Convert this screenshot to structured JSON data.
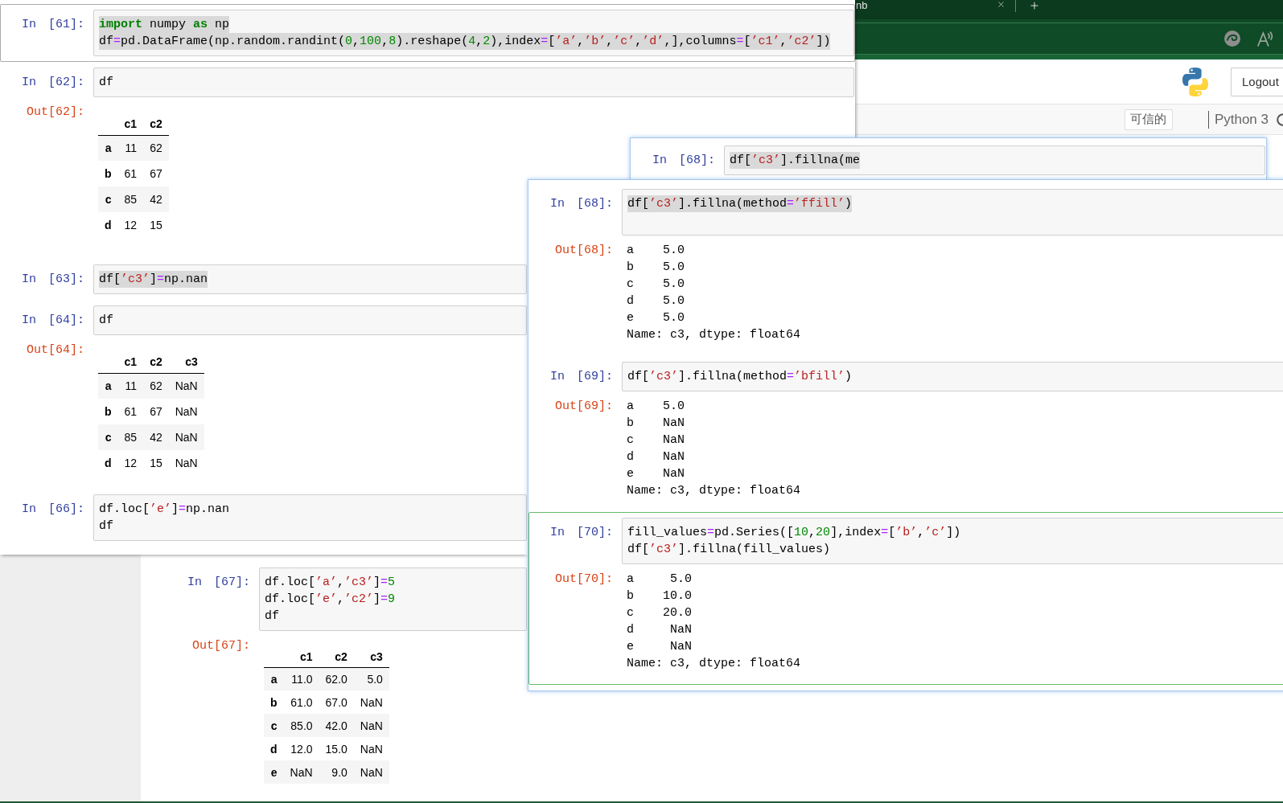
{
  "browser": {
    "tab_title": "nb"
  },
  "notebook_header": {
    "logout_label": "Logout"
  },
  "notebook_toolbar": {
    "trusted_label": "可信的",
    "kernel_name": "Python 3"
  },
  "background_notebook": {
    "cells": [
      {
        "prompt": "In [67]:",
        "selected": false,
        "editing": false,
        "code": [
          {
            "highlighted": false,
            "tokens": [
              {
                "kind": "plain",
                "text": "df.loc["
              },
              {
                "kind": "string",
                "text": "’a’"
              },
              {
                "kind": "plain",
                "text": ","
              },
              {
                "kind": "string",
                "text": "’c3’"
              },
              {
                "kind": "plain",
                "text": "]"
              },
              {
                "kind": "operator",
                "text": "="
              },
              {
                "kind": "number",
                "text": "5"
              }
            ]
          },
          {
            "highlighted": false,
            "tokens": [
              {
                "kind": "plain",
                "text": "df.loc["
              },
              {
                "kind": "string",
                "text": "’e’"
              },
              {
                "kind": "plain",
                "text": ","
              },
              {
                "kind": "string",
                "text": "’c2’"
              },
              {
                "kind": "plain",
                "text": "]"
              },
              {
                "kind": "operator",
                "text": "="
              },
              {
                "kind": "number",
                "text": "9"
              }
            ]
          },
          {
            "highlighted": false,
            "tokens": [
              {
                "kind": "plain",
                "text": "df"
              }
            ]
          }
        ],
        "output": {
          "prompt": "Out[67]:",
          "kind": "dataframe",
          "columns": [
            "c1",
            "c2",
            "c3"
          ],
          "rows": [
            {
              "index": "a",
              "values": [
                "11.0",
                "62.0",
                "5.0"
              ]
            },
            {
              "index": "b",
              "values": [
                "61.0",
                "67.0",
                "NaN"
              ]
            },
            {
              "index": "c",
              "values": [
                "85.0",
                "42.0",
                "NaN"
              ]
            },
            {
              "index": "d",
              "values": [
                "12.0",
                "15.0",
                "NaN"
              ]
            },
            {
              "index": "e",
              "values": [
                "NaN",
                "9.0",
                "NaN"
              ]
            }
          ]
        }
      }
    ]
  },
  "snippets": [
    {
      "cells": [
        {
          "prompt": "In [61]:",
          "selected": true,
          "editing": false,
          "code": [
            {
              "highlighted": true,
              "tokens": [
                {
                  "kind": "keyword",
                  "text": "import"
                },
                {
                  "kind": "plain",
                  "text": " numpy "
                },
                {
                  "kind": "keyword",
                  "text": "as"
                },
                {
                  "kind": "plain",
                  "text": " np"
                }
              ]
            },
            {
              "highlighted": true,
              "tokens": [
                {
                  "kind": "plain",
                  "text": "df"
                },
                {
                  "kind": "operator",
                  "text": "="
                },
                {
                  "kind": "plain",
                  "text": "pd.DataFrame(np.random.randint("
                },
                {
                  "kind": "number",
                  "text": "0"
                },
                {
                  "kind": "plain",
                  "text": ","
                },
                {
                  "kind": "number",
                  "text": "100"
                },
                {
                  "kind": "plain",
                  "text": ","
                },
                {
                  "kind": "number",
                  "text": "8"
                },
                {
                  "kind": "plain",
                  "text": ").reshape("
                },
                {
                  "kind": "number",
                  "text": "4"
                },
                {
                  "kind": "plain",
                  "text": ","
                },
                {
                  "kind": "number",
                  "text": "2"
                },
                {
                  "kind": "plain",
                  "text": "),index"
                },
                {
                  "kind": "operator",
                  "text": "="
                },
                {
                  "kind": "plain",
                  "text": "["
                },
                {
                  "kind": "string",
                  "text": "’a’"
                },
                {
                  "kind": "plain",
                  "text": ","
                },
                {
                  "kind": "string",
                  "text": "’b’"
                },
                {
                  "kind": "plain",
                  "text": ","
                },
                {
                  "kind": "string",
                  "text": "’c’"
                },
                {
                  "kind": "plain",
                  "text": ","
                },
                {
                  "kind": "string",
                  "text": "’d’"
                },
                {
                  "kind": "plain",
                  "text": ",],columns"
                },
                {
                  "kind": "operator",
                  "text": "="
                },
                {
                  "kind": "plain",
                  "text": "["
                },
                {
                  "kind": "string",
                  "text": "’c1’"
                },
                {
                  "kind": "plain",
                  "text": ","
                },
                {
                  "kind": "string",
                  "text": "’c2’"
                },
                {
                  "kind": "plain",
                  "text": "])"
                }
              ]
            }
          ]
        },
        {
          "prompt": "In [62]:",
          "selected": false,
          "editing": false,
          "code": [
            {
              "highlighted": false,
              "tokens": [
                {
                  "kind": "plain",
                  "text": "df"
                }
              ]
            }
          ],
          "output": {
            "prompt": "Out[62]:",
            "kind": "dataframe",
            "columns": [
              "c1",
              "c2"
            ],
            "rows": [
              {
                "index": "a",
                "values": [
                  "11",
                  "62"
                ]
              },
              {
                "index": "b",
                "values": [
                  "61",
                  "67"
                ]
              },
              {
                "index": "c",
                "values": [
                  "85",
                  "42"
                ]
              },
              {
                "index": "d",
                "values": [
                  "12",
                  "15"
                ]
              }
            ]
          }
        }
      ]
    },
    {
      "cells": [
        {
          "prompt": "In [63]:",
          "selected": false,
          "editing": false,
          "code": [
            {
              "highlighted": true,
              "tokens": [
                {
                  "kind": "plain",
                  "text": "df["
                },
                {
                  "kind": "string",
                  "text": "’c3’"
                },
                {
                  "kind": "plain",
                  "text": "]"
                },
                {
                  "kind": "operator",
                  "text": "="
                },
                {
                  "kind": "plain",
                  "text": "np.nan"
                }
              ]
            }
          ]
        },
        {
          "prompt": "In [64]:",
          "selected": false,
          "editing": false,
          "code": [
            {
              "highlighted": false,
              "tokens": [
                {
                  "kind": "plain",
                  "text": "df"
                }
              ]
            }
          ],
          "output": {
            "prompt": "Out[64]:",
            "kind": "dataframe",
            "columns": [
              "c1",
              "c2",
              "c3"
            ],
            "rows": [
              {
                "index": "a",
                "values": [
                  "11",
                  "62",
                  "NaN"
                ]
              },
              {
                "index": "b",
                "values": [
                  "61",
                  "67",
                  "NaN"
                ]
              },
              {
                "index": "c",
                "values": [
                  "85",
                  "42",
                  "NaN"
                ]
              },
              {
                "index": "d",
                "values": [
                  "12",
                  "15",
                  "NaN"
                ]
              }
            ]
          }
        },
        {
          "prompt": "In [66]:",
          "selected": false,
          "editing": false,
          "code": [
            {
              "highlighted": false,
              "tokens": [
                {
                  "kind": "plain",
                  "text": "df.loc["
                },
                {
                  "kind": "string",
                  "text": "’e’"
                },
                {
                  "kind": "plain",
                  "text": "]"
                },
                {
                  "kind": "operator",
                  "text": "="
                },
                {
                  "kind": "plain",
                  "text": "np.nan"
                }
              ]
            },
            {
              "highlighted": false,
              "tokens": [
                {
                  "kind": "plain",
                  "text": "df"
                }
              ]
            }
          ]
        }
      ]
    },
    {
      "cells": [
        {
          "prompt": "In [68]:",
          "selected": false,
          "editing": false,
          "code": [
            {
              "highlighted": true,
              "tokens": [
                {
                  "kind": "plain",
                  "text": "df["
                },
                {
                  "kind": "string",
                  "text": "’c3’"
                },
                {
                  "kind": "plain",
                  "text": "].fillna(me"
                }
              ]
            }
          ]
        }
      ]
    },
    {
      "cells": [
        {
          "prompt": "In [68]:",
          "selected": false,
          "editing": false,
          "code": [
            {
              "highlighted": true,
              "tokens": [
                {
                  "kind": "plain",
                  "text": "df["
                },
                {
                  "kind": "string",
                  "text": "’c3’"
                },
                {
                  "kind": "plain",
                  "text": "].fillna(method"
                },
                {
                  "kind": "operator",
                  "text": "="
                },
                {
                  "kind": "string",
                  "text": "’ffill’"
                },
                {
                  "kind": "plain",
                  "text": ")"
                }
              ]
            },
            {
              "highlighted": false
            }
          ],
          "output": {
            "prompt": "Out[68]:",
            "kind": "series",
            "lines": [
              "a    5.0",
              "b    5.0",
              "c    5.0",
              "d    5.0",
              "e    5.0",
              "Name: c3, dtype: float64"
            ]
          }
        },
        {
          "prompt": "In [69]:",
          "selected": false,
          "editing": false,
          "code": [
            {
              "highlighted": false,
              "tokens": [
                {
                  "kind": "plain",
                  "text": "df["
                },
                {
                  "kind": "string",
                  "text": "’c3’"
                },
                {
                  "kind": "plain",
                  "text": "].fillna(method"
                },
                {
                  "kind": "operator",
                  "text": "="
                },
                {
                  "kind": "string",
                  "text": "’bfill’"
                },
                {
                  "kind": "plain",
                  "text": ")"
                }
              ]
            }
          ],
          "output": {
            "prompt": "Out[69]:",
            "kind": "series",
            "lines": [
              "a    5.0",
              "b    NaN",
              "c    NaN",
              "d    NaN",
              "e    NaN",
              "Name: c3, dtype: float64"
            ]
          }
        },
        {
          "prompt": "In [70]:",
          "selected": false,
          "editing": true,
          "code": [
            {
              "highlighted": false,
              "tokens": [
                {
                  "kind": "plain",
                  "text": "fill_values"
                },
                {
                  "kind": "operator",
                  "text": "="
                },
                {
                  "kind": "plain",
                  "text": "pd.Series(["
                },
                {
                  "kind": "number",
                  "text": "10"
                },
                {
                  "kind": "plain",
                  "text": ","
                },
                {
                  "kind": "number",
                  "text": "20"
                },
                {
                  "kind": "plain",
                  "text": "],index"
                },
                {
                  "kind": "operator",
                  "text": "="
                },
                {
                  "kind": "plain",
                  "text": "["
                },
                {
                  "kind": "string",
                  "text": "’b’"
                },
                {
                  "kind": "plain",
                  "text": ","
                },
                {
                  "kind": "string",
                  "text": "’c’"
                },
                {
                  "kind": "plain",
                  "text": "])"
                }
              ]
            },
            {
              "highlighted": false,
              "tokens": [
                {
                  "kind": "plain",
                  "text": "df["
                },
                {
                  "kind": "string",
                  "text": "’c3’"
                },
                {
                  "kind": "plain",
                  "text": "].fillna(fill_values)"
                }
              ]
            }
          ],
          "output": {
            "prompt": "Out[70]:",
            "kind": "series",
            "lines": [
              "a     5.0",
              "b    10.0",
              "c    20.0",
              "d     NaN",
              "e     NaN",
              "Name: c3, dtype: float64"
            ]
          }
        }
      ]
    }
  ]
}
